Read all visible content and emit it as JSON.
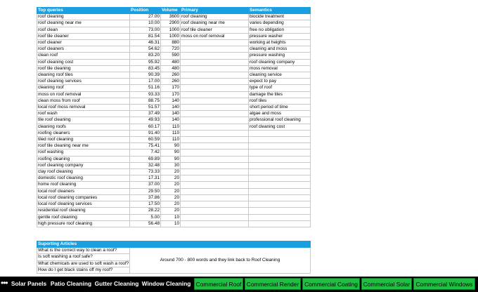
{
  "keywords": {
    "headers": [
      "Top queries",
      "Position",
      "Volume",
      "Primary",
      "Semantics"
    ],
    "rows": [
      [
        "roof cleaning",
        "27.00",
        "3600",
        "roof cleaning",
        "biocide treatment"
      ],
      [
        "roof cleaning near me",
        "10.00",
        "2900",
        "roof cleaning near me",
        "varies depending"
      ],
      [
        "roof clean",
        "73.00",
        "1000",
        "roof tile cleaner",
        "free no obligation"
      ],
      [
        "roof tile cleaner",
        "81.54",
        "1000",
        "moss on roof removal",
        "pressure washer"
      ],
      [
        "roof cleaner",
        "46.31",
        "880",
        "",
        "working at heights"
      ],
      [
        "roof cleaners",
        "54.62",
        "720",
        "",
        "cleaning and moss"
      ],
      [
        "clean roof",
        "83.20",
        "590",
        "",
        "pressure washing"
      ],
      [
        "roof cleaning cost",
        "95.92",
        "480",
        "",
        "roof cleaning company"
      ],
      [
        "roof tile cleaning",
        "83.45",
        "480",
        "",
        "moss removal"
      ],
      [
        "cleaning roof tiles",
        "90.39",
        "260",
        "",
        "cleaning service"
      ],
      [
        "roof cleaning services",
        "17.00",
        "260",
        "",
        "expect to pay"
      ],
      [
        "cleaning roof",
        "51.16",
        "170",
        "",
        "type of roof"
      ],
      [
        "moss on roof removal",
        "93.33",
        "170",
        "",
        "damage the tiles"
      ],
      [
        "clean moss from roof",
        "88.75",
        "140",
        "",
        "roof tiles"
      ],
      [
        "local roof moss removal",
        "51.57",
        "140",
        "",
        "short period of time"
      ],
      [
        "roof wash",
        "37.49",
        "140",
        "",
        "algae and moss"
      ],
      [
        "tile roof cleaning",
        "49.93",
        "140",
        "",
        "professional roof cleaning"
      ],
      [
        "cleaning roofs",
        "60.17",
        "110",
        "",
        "roof cleaning cost"
      ],
      [
        "roofing cleaners",
        "91.40",
        "110",
        "",
        ""
      ],
      [
        "tiled roof cleaning",
        "60.59",
        "110",
        "",
        ""
      ],
      [
        "roof tile cleaning near me",
        "75.41",
        "90",
        "",
        ""
      ],
      [
        "roof washing",
        "7.42",
        "90",
        "",
        ""
      ],
      [
        "roofing cleaning",
        "69.89",
        "90",
        "",
        ""
      ],
      [
        "roof cleaning company",
        "32.48",
        "30",
        "",
        ""
      ],
      [
        "clay roof cleaning",
        "73.33",
        "20",
        "",
        ""
      ],
      [
        "domestic roof cleaning",
        "17.31",
        "20",
        "",
        ""
      ],
      [
        "home roof cleaning",
        "37.00",
        "20",
        "",
        ""
      ],
      [
        "local roof cleaners",
        "29.50",
        "20",
        "",
        ""
      ],
      [
        "local roof cleaning companies",
        "37.86",
        "20",
        "",
        ""
      ],
      [
        "local roof cleaning services",
        "17.50",
        "20",
        "",
        ""
      ],
      [
        "residential roof cleaning",
        "28.22",
        "20",
        "",
        ""
      ],
      [
        "gentle roof cleaning",
        "5.00",
        "10",
        "",
        ""
      ],
      [
        "high pressure roof cleaning",
        "56.48",
        "10",
        "",
        ""
      ]
    ]
  },
  "articles": {
    "header": "Suporting Articles",
    "items": [
      "What is the correct way to clean a roof?",
      "Is soft washing a roof safe?",
      "What chemicals are used to soft wash a roof?",
      "How do I get black stains off my roof?"
    ],
    "note": "Around 700 - 800 words and they link back to Roof Cleaning"
  },
  "sheet_tabs": {
    "more_glyph": "•••",
    "tabs": [
      {
        "label": "Solar Panels",
        "style": "dark"
      },
      {
        "label": "Patio Cleaning",
        "style": "dark"
      },
      {
        "label": "Gutter Cleaning",
        "style": "dark"
      },
      {
        "label": "Window Cleaning",
        "style": "dark"
      },
      {
        "label": "Commercial Roof",
        "style": "green"
      },
      {
        "label": "Commercial Render",
        "style": "green"
      },
      {
        "label": "Commercial Coating",
        "style": "green"
      },
      {
        "label": "Commercial Solar",
        "style": "green"
      },
      {
        "label": "Commercial Windows",
        "style": "green"
      }
    ]
  },
  "colors": {
    "header_fill": "#1a9fe0",
    "tab_green": "#1fbf44",
    "tab_bar": "#000000"
  }
}
